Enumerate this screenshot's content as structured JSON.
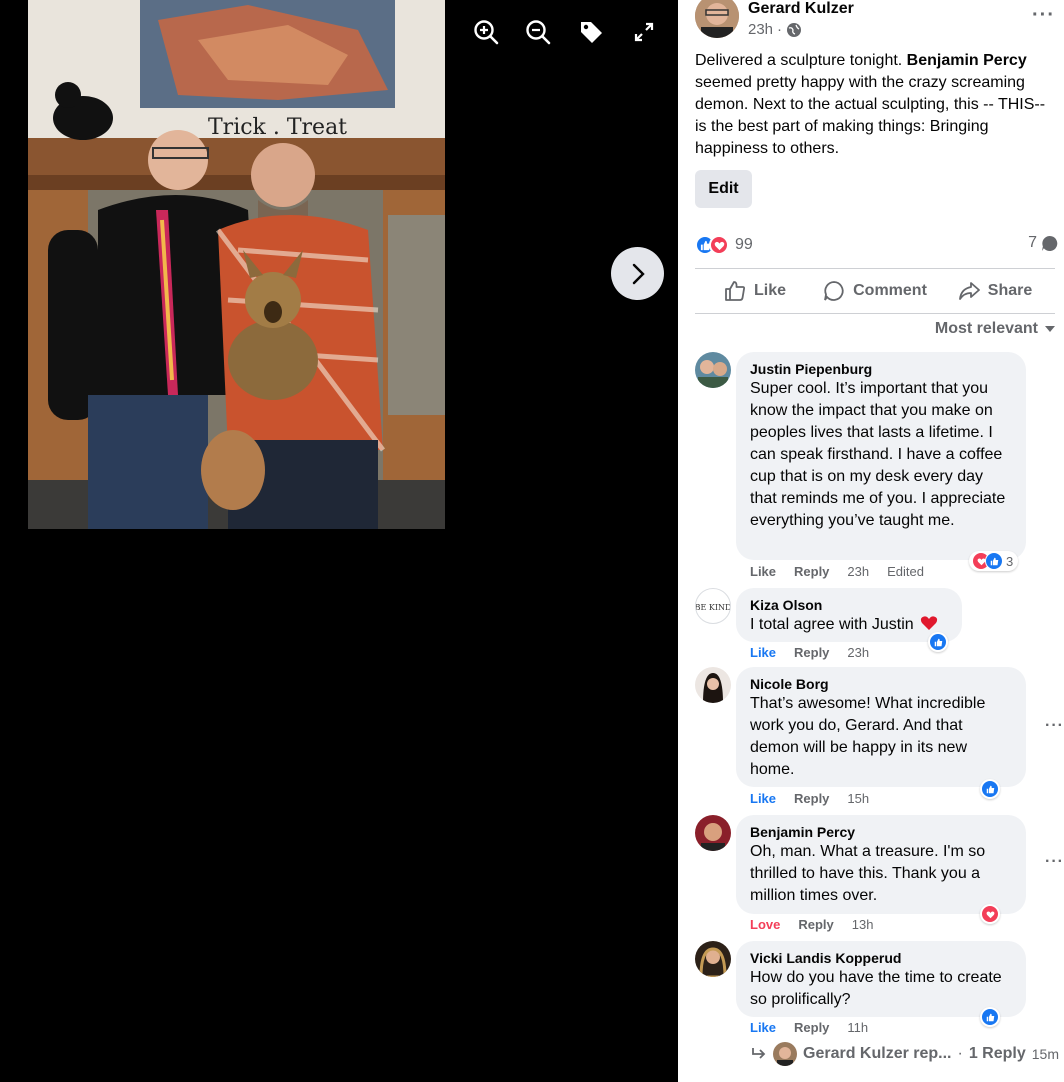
{
  "viewer": {
    "icons": [
      "zoom-in-icon",
      "zoom-out-icon",
      "tag-icon",
      "fullscreen-icon"
    ],
    "next_icon": "chevron-right-icon"
  },
  "post": {
    "author": "Gerard Kulzer",
    "time": "23h",
    "time_separator": "·",
    "privacy_icon": "globe-icon",
    "more": "···",
    "text_before": "Delivered a sculpture tonight. ",
    "text_mention": "Benjamin Percy",
    "text_after": " seemed pretty happy with the crazy screaming demon. Next to the actual sculpting, this -- THIS-- is the best part of making things: Bringing happiness to others.",
    "edit_label": "Edit",
    "reaction_count": "99",
    "comment_count": "7",
    "actions": {
      "like": "Like",
      "comment": "Comment",
      "share": "Share"
    },
    "sort_label": "Most relevant"
  },
  "colors": {
    "like_blue": "#1877f2",
    "love_red": "#f33e58",
    "text": "#050505",
    "muted": "#65676b",
    "bubble": "#f0f2f5"
  },
  "comments": [
    {
      "name": "Justin Piepenburg",
      "text": "Super cool. It’s important that you know the impact that you make on peoples lives that lasts a lifetime. I can speak firsthand. I have a coffee cup that is on my desk every day that reminds me of you. I appreciate everything you’ve taught me.",
      "like": "Like",
      "reply": "Reply",
      "time": "23h",
      "edited": "Edited",
      "reaction_count": "3"
    },
    {
      "name": "Kiza Olson",
      "text": "I total agree with Justin",
      "like": "Like",
      "reply": "Reply",
      "time": "23h"
    },
    {
      "name": "Nicole Borg",
      "text": "That’s awesome! What incredible work you do, Gerard. And that demon will be happy in its new home.",
      "like": "Like",
      "reply": "Reply",
      "time": "15h"
    },
    {
      "name": "Benjamin Percy",
      "text": "Oh, man. What a treasure. I'm so thrilled to have this. Thank you a million times over.",
      "like": "Love",
      "reply": "Reply",
      "time": "13h"
    },
    {
      "name": "Vicki Landis Kopperud",
      "text": "How do you have the time to create so prolifically?",
      "like": "Like",
      "reply": "Reply",
      "time": "11h"
    }
  ],
  "reply_summary": {
    "author": "Gerard Kulzer rep...",
    "separator": " · ",
    "count": "1 Reply",
    "time": "15m"
  }
}
